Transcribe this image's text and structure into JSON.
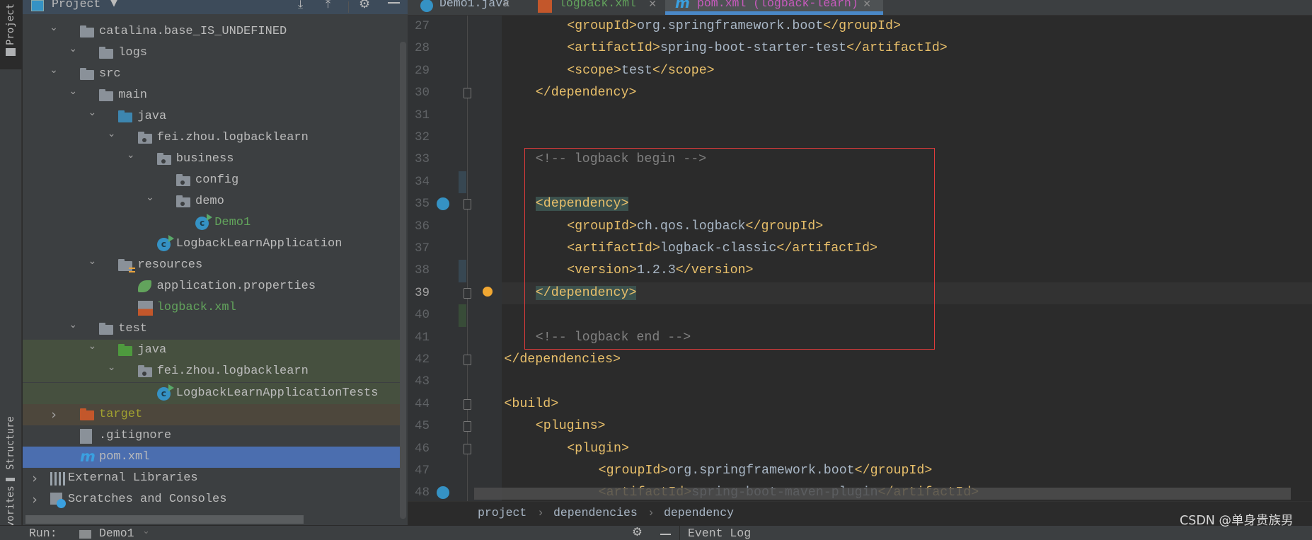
{
  "sidebar_strip": {
    "tabs": [
      "Project",
      "Structure",
      "Favorites"
    ]
  },
  "project_panel": {
    "title": "Project",
    "items": [
      {
        "label": "catalina.base_IS_UNDEFINED",
        "depth": 0,
        "chevron": "down",
        "icon": "folder"
      },
      {
        "label": "logs",
        "depth": 1,
        "chevron": "down",
        "icon": "folder"
      },
      {
        "label": "src",
        "depth": 0,
        "chevron": "down",
        "icon": "folder"
      },
      {
        "label": "main",
        "depth": 1,
        "chevron": "down",
        "icon": "folder"
      },
      {
        "label": "java",
        "depth": 2,
        "chevron": "down",
        "icon": "source-folder"
      },
      {
        "label": "fei.zhou.logbacklearn",
        "depth": 3,
        "chevron": "down",
        "icon": "package"
      },
      {
        "label": "business",
        "depth": 4,
        "chevron": "down",
        "icon": "package"
      },
      {
        "label": "config",
        "depth": 5,
        "chevron": "",
        "icon": "package"
      },
      {
        "label": "demo",
        "depth": 5,
        "chevron": "down",
        "icon": "package"
      },
      {
        "label": "Demo1",
        "depth": 6,
        "chevron": "",
        "icon": "class-run",
        "color": "#62a35c"
      },
      {
        "label": "LogbackLearnApplication",
        "depth": 4,
        "chevron": "",
        "icon": "class-spring"
      },
      {
        "label": "resources",
        "depth": 2,
        "chevron": "down",
        "icon": "resources-folder"
      },
      {
        "label": "application.properties",
        "depth": 3,
        "chevron": "",
        "icon": "spring-properties"
      },
      {
        "label": "logback.xml",
        "depth": 3,
        "chevron": "",
        "icon": "xml-file",
        "color": "#62a35c"
      },
      {
        "label": "test",
        "depth": 1,
        "chevron": "down",
        "icon": "folder"
      },
      {
        "label": "java",
        "depth": 2,
        "chevron": "down",
        "icon": "test-folder",
        "bg": "#46503f"
      },
      {
        "label": "fei.zhou.logbacklearn",
        "depth": 3,
        "chevron": "down",
        "icon": "package",
        "bg": "#46503f"
      },
      {
        "label": "LogbackLearnApplicationTests",
        "depth": 4,
        "chevron": "",
        "icon": "class-test",
        "bg": "#46503f"
      },
      {
        "label": "target",
        "depth": 0,
        "chevron": "right",
        "icon": "excluded-folder",
        "color": "#a0a030",
        "bg": "#4d473c"
      },
      {
        "label": ".gitignore",
        "depth": 0,
        "chevron": "",
        "icon": "ignore-file"
      },
      {
        "label": "pom.xml",
        "depth": 0,
        "chevron": "",
        "icon": "maven",
        "bg": "#4b6eaf",
        "selected": true
      },
      {
        "label": "External Libraries",
        "depth": -1,
        "chevron": "right",
        "icon": "libraries"
      },
      {
        "label": "Scratches and Consoles",
        "depth": -1,
        "chevron": "right",
        "icon": "scratches"
      }
    ]
  },
  "editor_tabs": [
    {
      "label": "Demo1.java",
      "icon": "class",
      "color": "#a9b7c6"
    },
    {
      "label": "logback.xml",
      "icon": "xml",
      "color": "#62a35c"
    },
    {
      "label": "pom.xml (logback-learn)",
      "icon": "maven",
      "color": "#c75abd",
      "active": true
    }
  ],
  "code": [
    {
      "n": "27",
      "indent": 3,
      "tokens": [
        [
          "tag",
          "<groupId>"
        ],
        [
          "text",
          "org.springframework.boot"
        ],
        [
          "tag",
          "</groupId>"
        ]
      ]
    },
    {
      "n": "28",
      "indent": 3,
      "tokens": [
        [
          "tag",
          "<artifactId>"
        ],
        [
          "text",
          "spring-boot-starter-test"
        ],
        [
          "tag",
          "</artifactId>"
        ]
      ]
    },
    {
      "n": "29",
      "indent": 3,
      "tokens": [
        [
          "tag",
          "<scope>"
        ],
        [
          "text",
          "test"
        ],
        [
          "tag",
          "</scope>"
        ]
      ]
    },
    {
      "n": "30",
      "indent": 2,
      "tokens": [
        [
          "tag",
          "</dependency>"
        ]
      ]
    },
    {
      "n": "31",
      "indent": 0,
      "tokens": []
    },
    {
      "n": "32",
      "indent": 0,
      "tokens": []
    },
    {
      "n": "33",
      "indent": 2,
      "tokens": [
        [
          "comment",
          "<!-- logback begin -->"
        ]
      ]
    },
    {
      "n": "34",
      "indent": 0,
      "tokens": []
    },
    {
      "n": "35",
      "indent": 2,
      "tokens": [
        [
          "tag-hl",
          "<dependency>"
        ]
      ]
    },
    {
      "n": "36",
      "indent": 3,
      "tokens": [
        [
          "tag",
          "<groupId>"
        ],
        [
          "text",
          "ch.qos.logback"
        ],
        [
          "tag",
          "</groupId>"
        ]
      ]
    },
    {
      "n": "37",
      "indent": 3,
      "tokens": [
        [
          "tag",
          "<artifactId>"
        ],
        [
          "text",
          "logback-classic"
        ],
        [
          "tag",
          "</artifactId>"
        ]
      ]
    },
    {
      "n": "38",
      "indent": 3,
      "tokens": [
        [
          "tag",
          "<version>"
        ],
        [
          "text",
          "1.2.3"
        ],
        [
          "tag",
          "</version>"
        ]
      ]
    },
    {
      "n": "39",
      "indent": 2,
      "current": true,
      "tokens": [
        [
          "tag-hl",
          "</dependency>"
        ]
      ]
    },
    {
      "n": "40",
      "indent": 0,
      "tokens": []
    },
    {
      "n": "41",
      "indent": 2,
      "tokens": [
        [
          "comment",
          "<!-- logback end -->"
        ]
      ]
    },
    {
      "n": "42",
      "indent": 1,
      "tokens": [
        [
          "tag",
          "</dependencies>"
        ]
      ]
    },
    {
      "n": "43",
      "indent": 0,
      "tokens": []
    },
    {
      "n": "44",
      "indent": 1,
      "tokens": [
        [
          "tag",
          "<build>"
        ]
      ]
    },
    {
      "n": "45",
      "indent": 2,
      "tokens": [
        [
          "tag",
          "<plugins>"
        ]
      ]
    },
    {
      "n": "46",
      "indent": 3,
      "tokens": [
        [
          "tag",
          "<plugin>"
        ]
      ]
    },
    {
      "n": "47",
      "indent": 4,
      "tokens": [
        [
          "tag",
          "<groupId>"
        ],
        [
          "text",
          "org.springframework.boot"
        ],
        [
          "tag",
          "</groupId>"
        ]
      ]
    },
    {
      "n": "48",
      "indent": 4,
      "tokens": [
        [
          "tag",
          "<artifactId>"
        ],
        [
          "text",
          "spring-boot-maven-plugin"
        ],
        [
          "tag",
          "</artifactId>"
        ]
      ]
    }
  ],
  "breadcrumbs": [
    "project",
    "dependencies",
    "dependency"
  ],
  "bottom_bar": {
    "run_label": "Run:",
    "run_config": "Demo1",
    "event_log": "Event Log"
  },
  "watermark": "CSDN @单身贵族男",
  "colors": {
    "accent": "#4a88c7",
    "highlight_box": "#e03c3c",
    "selection": "#4b6eaf"
  }
}
